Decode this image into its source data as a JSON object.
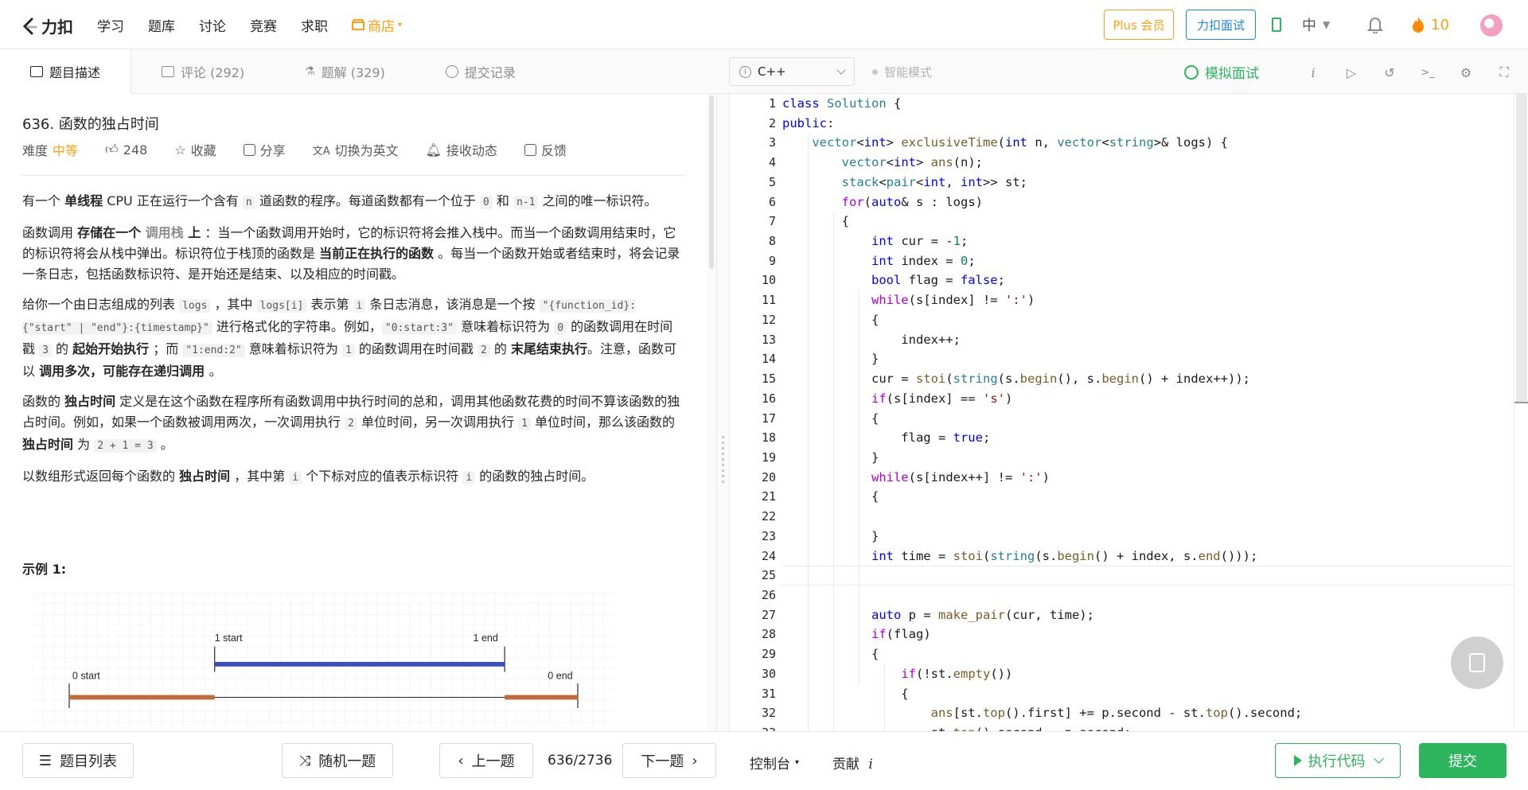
{
  "topnav": {
    "logo_text": "力扣",
    "links": [
      "学习",
      "题库",
      "讨论",
      "竞赛",
      "求职"
    ],
    "store_label": "商店",
    "plus_label": "Plus 会员",
    "interview_label": "力扣面试",
    "lang_label": "中",
    "streak_count": "10"
  },
  "tabs": [
    {
      "label": "题目描述",
      "icon": "description-icon"
    },
    {
      "label": "评论 (292)",
      "icon": "comment-icon"
    },
    {
      "label": "题解 (329)",
      "icon": "flask-icon"
    },
    {
      "label": "提交记录",
      "icon": "history-icon"
    }
  ],
  "editor_bar": {
    "language": "C++",
    "smart_mode": "智能模式",
    "mock_interview": "模拟面试"
  },
  "problem": {
    "title": "636. 函数的独占时间",
    "difficulty_label": "难度",
    "difficulty": "中等",
    "likes": "248",
    "favorite": "收藏",
    "share": "分享",
    "switch_lang": "切换为英文",
    "subscribe": "接收动态",
    "feedback": "反馈",
    "example_title": "示例 1:"
  },
  "diagram": {
    "labels": [
      "1 start",
      "1 end",
      "0 start",
      "0 end"
    ],
    "colors": {
      "fn1": "#3b4fbf",
      "fn0": "#c26a3a"
    }
  },
  "code_lines": [
    "class Solution {",
    "public:",
    "    vector<int> exclusiveTime(int n, vector<string>& logs) {",
    "        vector<int> ans(n);",
    "        stack<pair<int, int>> st;",
    "        for(auto& s : logs)",
    "        {",
    "            int cur = -1;",
    "            int index = 0;",
    "            bool flag = false;",
    "            while(s[index] != ':')",
    "            {",
    "                index++;",
    "            }",
    "            cur = stoi(string(s.begin(), s.begin() + index++));",
    "            if(s[index] == 's')",
    "            {",
    "                flag = true;",
    "            }",
    "            while(s[index++] != ':')",
    "            {",
    "",
    "            }",
    "            int time = stoi(string(s.begin() + index, s.end()));",
    "",
    "",
    "            auto p = make_pair(cur, time);",
    "            if(flag)",
    "            {",
    "                if(!st.empty())",
    "                {",
    "                    ans[st.top().first] += p.second - st.top().second;",
    "                    st.top().second = p.second;"
  ],
  "bottom": {
    "problem_list": "题目列表",
    "random": "随机一题",
    "prev": "上一题",
    "pager": "636/2736",
    "next": "下一题",
    "console": "控制台",
    "contribute": "贡献",
    "run": "执行代码",
    "submit": "提交"
  }
}
